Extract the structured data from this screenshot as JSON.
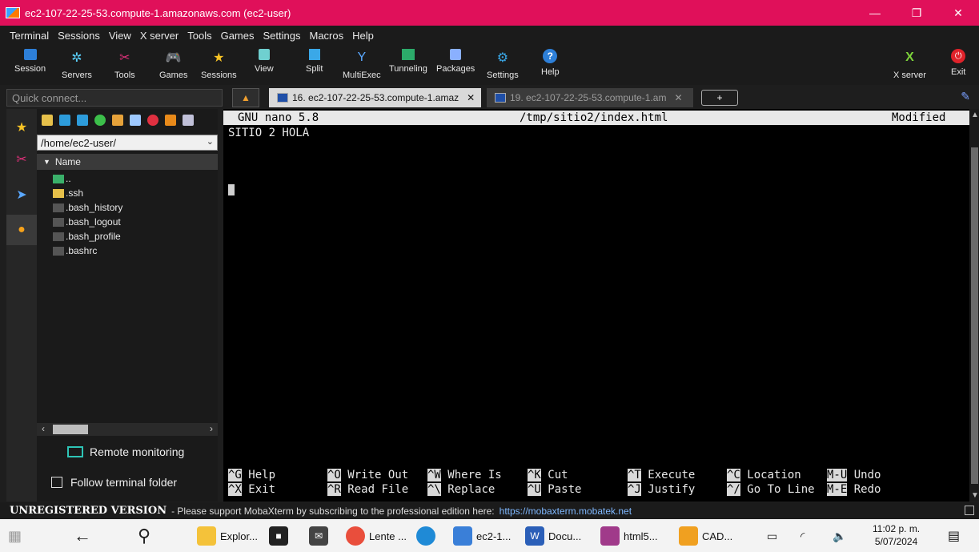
{
  "window": {
    "title": "ec2-107-22-25-53.compute-1.amazonaws.com (ec2-user)",
    "controls": [
      "—",
      "❐",
      "✕"
    ]
  },
  "menu": [
    "Terminal",
    "Sessions",
    "View",
    "X server",
    "Tools",
    "Games",
    "Settings",
    "Macros",
    "Help"
  ],
  "toolbar": {
    "session": "Session",
    "servers": "Servers",
    "tools": "Tools",
    "games": "Games",
    "sessions": "Sessions",
    "view": "View",
    "split": "Split",
    "multiexec": "MultiExec",
    "tunneling": "Tunneling",
    "packages": "Packages",
    "settings": "Settings",
    "help": "Help",
    "xserver": "X server",
    "exit": "Exit"
  },
  "quick_connect": {
    "placeholder": "Quick connect..."
  },
  "tabs": [
    {
      "label": "16. ec2-107-22-25-53.compute-1.amaz",
      "close": "✕"
    },
    {
      "label": "19. ec2-107-22-25-53.compute-1.am",
      "close": "✕"
    }
  ],
  "files": {
    "path": "/home/ec2-user/",
    "column_header": "Name",
    "items": [
      "..",
      ".ssh",
      ".bash_history",
      ".bash_logout",
      ".bash_profile",
      ".bashrc"
    ]
  },
  "sidebar": {
    "remote_monitoring": "Remote monitoring",
    "follow_terminal": "Follow terminal folder"
  },
  "nano": {
    "version": "GNU nano 5.8",
    "file": "/tmp/sitio2/index.html",
    "state": "Modified",
    "content_line": "SITIO 2 HOLA",
    "shortcuts_row1": [
      {
        "key": "^G",
        "label": "Help"
      },
      {
        "key": "^O",
        "label": "Write Out"
      },
      {
        "key": "^W",
        "label": "Where Is"
      },
      {
        "key": "^K",
        "label": "Cut"
      },
      {
        "key": "^T",
        "label": "Execute"
      },
      {
        "key": "^C",
        "label": "Location"
      },
      {
        "key": "M-U",
        "label": "Undo"
      }
    ],
    "shortcuts_row2": [
      {
        "key": "^X",
        "label": "Exit"
      },
      {
        "key": "^R",
        "label": "Read File"
      },
      {
        "key": "^\\",
        "label": "Replace"
      },
      {
        "key": "^U",
        "label": "Paste"
      },
      {
        "key": "^J",
        "label": "Justify"
      },
      {
        "key": "^/",
        "label": "Go To Line"
      },
      {
        "key": "M-E",
        "label": "Redo"
      }
    ]
  },
  "status": {
    "unregistered": "UNREGISTERED VERSION",
    "message": "-  Please support MobaXterm by subscribing to the professional edition here:",
    "link": "https://mobaxterm.mobatek.net"
  },
  "taskbar": {
    "explorer": "Explor...",
    "lente": "Lente ...",
    "ec2": "ec2-1...",
    "docu": "Docu...",
    "html5": "html5...",
    "cad": "CAD...",
    "time": "11:02 p. m.",
    "date": "5/07/2024"
  }
}
